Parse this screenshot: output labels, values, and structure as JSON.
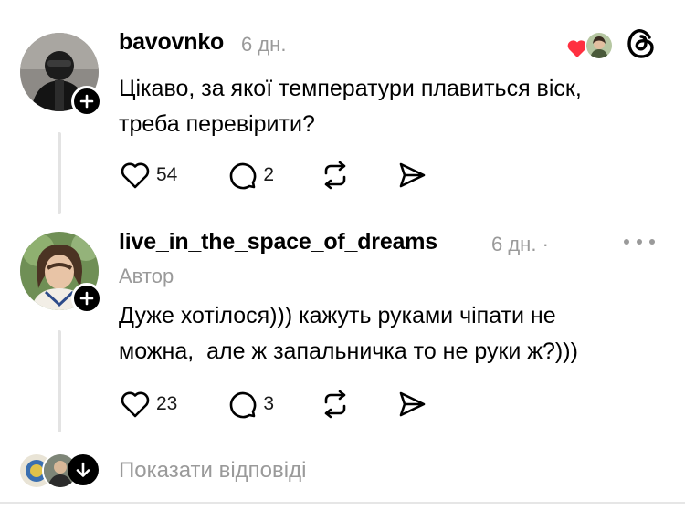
{
  "post1": {
    "username": "bavovnko",
    "time": "6 дн.",
    "text_lines": [
      "Цікаво, за якої температури плавиться віск,",
      "треба перевірити?"
    ],
    "likes": "54",
    "comments": "2"
  },
  "post2": {
    "username": "live_in_the_space_of_dreams",
    "time": "6 дн.",
    "separator": "·",
    "author_label": "Автор",
    "text_lines": [
      "Дуже хотілося))) кажуть руками чіпати не",
      "можна,  але ж запальничка то не руки ж?)))"
    ],
    "likes": "23",
    "comments": "3"
  },
  "footer": {
    "show_replies": "Показати відповіді"
  },
  "colors": {
    "accent_red": "#ff3040",
    "muted": "#9a9a9a"
  },
  "icons": [
    "plus-icon",
    "heart-icon",
    "comment-icon",
    "repost-icon",
    "share-icon",
    "threads-logo-icon",
    "more-icon",
    "arrow-down-icon"
  ]
}
